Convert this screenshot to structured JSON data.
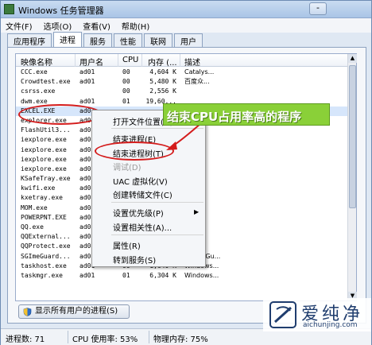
{
  "window": {
    "title": "Windows 任务管理器",
    "minimize_label": "-"
  },
  "menu": [
    "文件(F)",
    "选项(O)",
    "查看(V)",
    "帮助(H)"
  ],
  "tabs": [
    {
      "label": "应用程序",
      "active": false
    },
    {
      "label": "进程",
      "active": true
    },
    {
      "label": "服务",
      "active": false
    },
    {
      "label": "性能",
      "active": false
    },
    {
      "label": "联网",
      "active": false
    },
    {
      "label": "用户",
      "active": false
    }
  ],
  "columns": {
    "name": "映像名称",
    "user": "用户名",
    "cpu": "CPU",
    "mem": "内存 (...",
    "desc": "描述"
  },
  "processes": [
    {
      "name": "CCC.exe",
      "user": "ad01",
      "cpu": "00",
      "mem": "4,604 K",
      "desc": "Catalys..."
    },
    {
      "name": "Crowdtest.exe",
      "user": "ad01",
      "cpu": "00",
      "mem": "5,480 K",
      "desc": "百度众..."
    },
    {
      "name": "csrss.exe",
      "user": "",
      "cpu": "00",
      "mem": "2,556 K",
      "desc": ""
    },
    {
      "name": "dwm.exe",
      "user": "ad01",
      "cpu": "01",
      "mem": "19,60...",
      "desc": ""
    },
    {
      "name": "EXCEL.EXE",
      "user": "ad01",
      "cpu": "",
      "mem": "",
      "desc": ""
    },
    {
      "name": "explorer.exe",
      "user": "ad01",
      "cpu": "",
      "mem": "",
      "desc": ""
    },
    {
      "name": "FlashUtil3...",
      "user": "ad01",
      "cpu": "",
      "mem": "",
      "desc": ""
    },
    {
      "name": "iexplore.exe",
      "user": "ad01",
      "cpu": "",
      "mem": "",
      "desc": ""
    },
    {
      "name": "iexplore.exe",
      "user": "ad01",
      "cpu": "",
      "mem": "",
      "desc": ""
    },
    {
      "name": "iexplore.exe",
      "user": "ad01",
      "cpu": "",
      "mem": "",
      "desc": ""
    },
    {
      "name": "iexplore.exe",
      "user": "ad01",
      "cpu": "",
      "mem": "",
      "desc": ""
    },
    {
      "name": "KSafeTray.exe",
      "user": "ad01",
      "cpu": "",
      "mem": "",
      "desc": ""
    },
    {
      "name": "kwifi.exe",
      "user": "ad01",
      "cpu": "",
      "mem": "",
      "desc": ""
    },
    {
      "name": "kxetray.exe",
      "user": "ad01",
      "cpu": "",
      "mem": "",
      "desc": ""
    },
    {
      "name": "MOM.exe",
      "user": "ad01",
      "cpu": "",
      "mem": "",
      "desc": ""
    },
    {
      "name": "POWERPNT.EXE",
      "user": "ad01",
      "cpu": "",
      "mem": "",
      "desc": ""
    },
    {
      "name": "QQ.exe",
      "user": "ad01",
      "cpu": "",
      "mem": "",
      "desc": ""
    },
    {
      "name": "QQExternal...",
      "user": "ad01",
      "cpu": "",
      "mem": "",
      "desc": ""
    },
    {
      "name": "QQProtect.exe",
      "user": "ad01",
      "cpu": "",
      "mem": "",
      "desc": ""
    },
    {
      "name": "SGImeGuard...",
      "user": "ad01",
      "cpu": "00",
      "mem": "6,924 K",
      "desc": "SGImeGu..."
    },
    {
      "name": "taskhost.exe",
      "user": "ad01",
      "cpu": "00",
      "mem": "1,640 K",
      "desc": "Windows..."
    },
    {
      "name": "taskmgr.exe",
      "user": "ad01",
      "cpu": "01",
      "mem": "6,304 K",
      "desc": "Windows..."
    }
  ],
  "context_menu": {
    "open_location": "打开文件位置(O)",
    "end_process": "结束进程(E)",
    "end_tree": "结束进程树(T)",
    "debug": "调试(D)",
    "uac": "UAC 虚拟化(V)",
    "dump": "创建转储文件(C)",
    "priority": "设置优先级(P)",
    "affinity": "设置相关性(A)...",
    "properties": "属性(R)",
    "goto_service": "转到服务(S)",
    "submenu_arrow": "▶"
  },
  "callout": {
    "text": "结束CPU占用率高的程序"
  },
  "show_all_button": "显示所有用户的进程(S)",
  "status": {
    "processes": "进程数: 71",
    "cpu": "CPU 使用率: 53%",
    "memory": "物理内存: 75%"
  },
  "watermark": {
    "title": "爱纯净",
    "url": "aichunjing.com"
  },
  "scroll": {
    "up": "▲",
    "down": "▼"
  },
  "colors": {
    "annotation_red": "#d41c1c",
    "callout_green": "#8ad038"
  }
}
